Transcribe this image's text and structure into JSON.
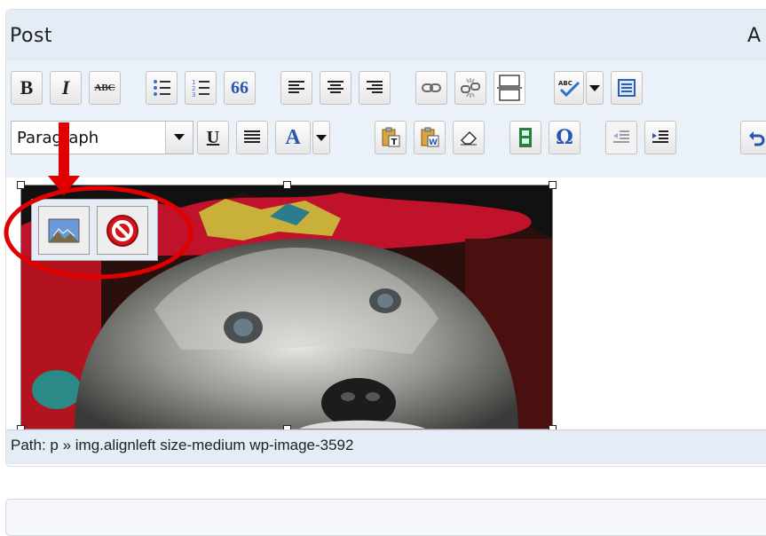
{
  "post_box": {
    "title": "Post",
    "right_cut_text": "A"
  },
  "toolbar": {
    "row1": [
      {
        "name": "bold-button",
        "label": "B"
      },
      {
        "name": "italic-button",
        "label": "I"
      },
      {
        "name": "strikethrough-button",
        "label": "ABC"
      },
      {
        "name": "bullet-list-button",
        "icon": "bullet-list-icon"
      },
      {
        "name": "numbered-list-button",
        "icon": "numbered-list-icon"
      },
      {
        "name": "blockquote-button",
        "label": "66"
      },
      {
        "name": "align-left-button",
        "icon": "align-left-icon"
      },
      {
        "name": "align-center-button",
        "icon": "align-center-icon"
      },
      {
        "name": "align-right-button",
        "icon": "align-right-icon"
      },
      {
        "name": "insert-link-button",
        "icon": "link-icon"
      },
      {
        "name": "unlink-button",
        "icon": "unlink-icon"
      },
      {
        "name": "insert-more-button",
        "icon": "more-tag-icon"
      },
      {
        "name": "spellcheck-button",
        "icon": "spellcheck-icon"
      },
      {
        "name": "spellcheck-dropdown",
        "icon": "chevron-down-icon"
      },
      {
        "name": "fullscreen-button",
        "icon": "fullscreen-icon"
      }
    ],
    "format_select": {
      "value": "Paragraph"
    },
    "row2": [
      {
        "name": "underline-button",
        "label": "U"
      },
      {
        "name": "justify-button",
        "icon": "justify-icon"
      },
      {
        "name": "text-color-button",
        "label": "A"
      },
      {
        "name": "paste-text-button",
        "icon": "paste-text-icon",
        "label": "T"
      },
      {
        "name": "paste-word-button",
        "icon": "paste-word-icon",
        "label": "W"
      },
      {
        "name": "remove-format-button",
        "icon": "eraser-icon"
      },
      {
        "name": "insert-media-button",
        "icon": "film-icon"
      },
      {
        "name": "special-char-button",
        "label": "Ω"
      },
      {
        "name": "outdent-button",
        "icon": "outdent-icon"
      },
      {
        "name": "indent-button",
        "icon": "indent-icon"
      },
      {
        "name": "undo-button",
        "icon": "undo-icon"
      }
    ]
  },
  "image_toolbar": {
    "edit": {
      "icon": "edit-image-icon"
    },
    "delete": {
      "icon": "delete-image-icon"
    }
  },
  "status": {
    "path": "Path: p » img.alignleft size-medium wp-image-3592"
  },
  "colors": {
    "header_bg": "#e4ecf6",
    "toolbar_bg": "#ebf1f9",
    "annotation_red": "#e00000"
  }
}
